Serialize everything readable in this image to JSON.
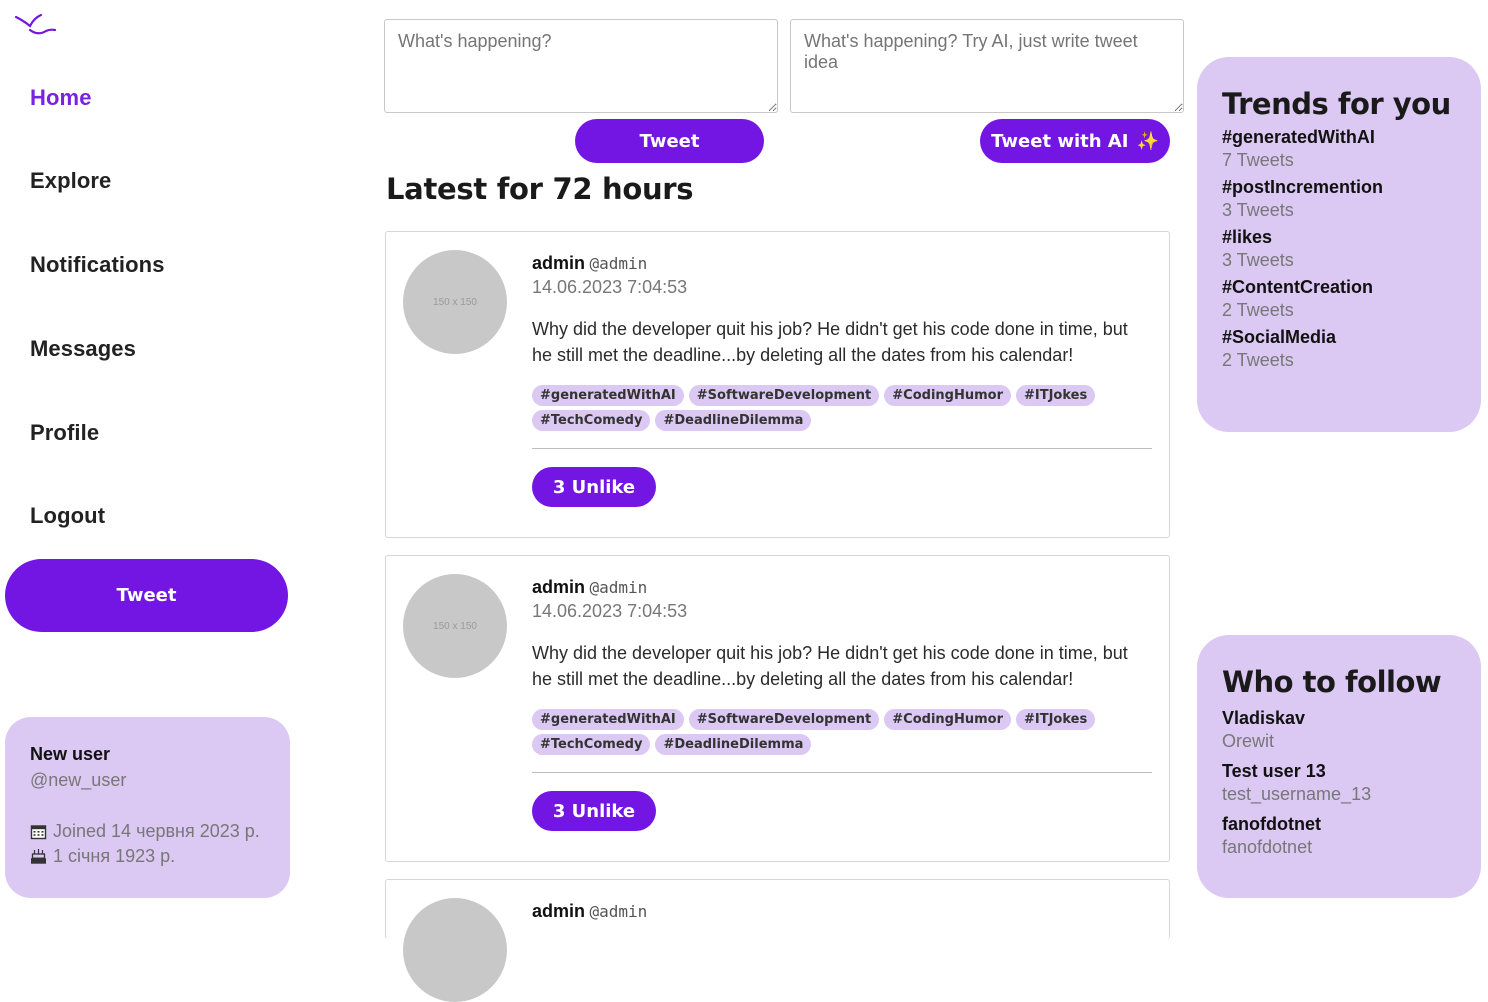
{
  "nav": {
    "items": [
      {
        "label": "Home",
        "active": true
      },
      {
        "label": "Explore"
      },
      {
        "label": "Notifications"
      },
      {
        "label": "Messages"
      },
      {
        "label": "Profile"
      },
      {
        "label": "Logout"
      }
    ],
    "tweet_button": "Tweet"
  },
  "user": {
    "name": "New user",
    "handle": "@new_user",
    "joined": "Joined 14 червня 2023 р.",
    "birthday": "1 січня 1923 р."
  },
  "compose": {
    "placeholder": "What's happening?",
    "ai_placeholder": "What's happening? Try AI, just write tweet idea",
    "tweet_button": "Tweet",
    "ai_button": "Tweet with AI",
    "ai_icon": "sparkles-icon"
  },
  "feed": {
    "title": "Latest for 72 hours",
    "tweets": [
      {
        "avatar_label": "150 x 150",
        "author": "admin",
        "handle": "@admin",
        "date": "14.06.2023 7:04:53",
        "text": "Why did the developer quit his job? He didn't get his code done in time, but he still met the deadline...by deleting all the dates from his calendar!",
        "tags": [
          "#generatedWithAI",
          "#SoftwareDevelopment",
          "#CodingHumor",
          "#ITJokes",
          "#TechComedy",
          "#DeadlineDilemma"
        ],
        "like_button": "3 Unlike"
      },
      {
        "avatar_label": "150 x 150",
        "author": "admin",
        "handle": "@admin",
        "date": "14.06.2023 7:04:53",
        "text": "Why did the developer quit his job? He didn't get his code done in time, but he still met the deadline...by deleting all the dates from his calendar!",
        "tags": [
          "#generatedWithAI",
          "#SoftwareDevelopment",
          "#CodingHumor",
          "#ITJokes",
          "#TechComedy",
          "#DeadlineDilemma"
        ],
        "like_button": "3 Unlike"
      },
      {
        "avatar_label": "",
        "author": "admin",
        "handle": "@admin"
      }
    ]
  },
  "trends": {
    "title": "Trends for you",
    "items": [
      {
        "tag": "#generatedWithAI",
        "count": "7 Tweets"
      },
      {
        "tag": "#postIncremention",
        "count": "3 Tweets"
      },
      {
        "tag": "#likes",
        "count": "3 Tweets"
      },
      {
        "tag": "#ContentCreation",
        "count": "2 Tweets"
      },
      {
        "tag": "#SocialMedia",
        "count": "2 Tweets"
      }
    ]
  },
  "who_to_follow": {
    "title": "Who to follow",
    "items": [
      {
        "name": "Vladiskav",
        "username": "Orewit"
      },
      {
        "name": "Test user 13",
        "username": "test_username_13"
      },
      {
        "name": "fanofdotnet",
        "username": "fanofdotnet"
      }
    ]
  },
  "colors": {
    "accent": "#7316e3",
    "accent_text": "#7a22e3",
    "panel": "#dbc8f3"
  }
}
